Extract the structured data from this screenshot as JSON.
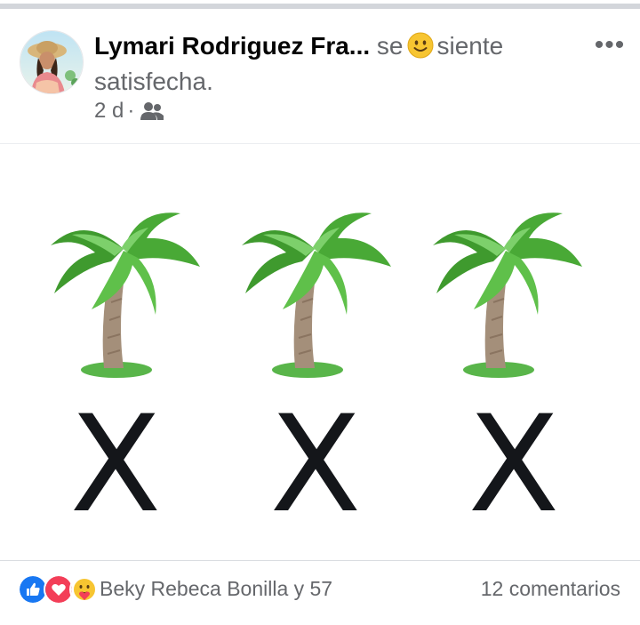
{
  "post": {
    "author": "Lymari Rodriguez Fra...",
    "feeling_prefix": "se",
    "feeling_text": "siente satisfecha.",
    "feeling_emoji": "smile-emoji",
    "time": "2 d",
    "separator": "·",
    "audience_icon": "friends-icon",
    "more_label": "•••"
  },
  "image": {
    "items": [
      {
        "icon": "palm-tree-emoji",
        "mark": "X"
      },
      {
        "icon": "palm-tree-emoji",
        "mark": "X"
      },
      {
        "icon": "palm-tree-emoji",
        "mark": "X"
      }
    ]
  },
  "footer": {
    "reaction_icons": [
      "like-icon",
      "love-icon",
      "care-icon"
    ],
    "reaction_text": "Beky Rebeca Bonilla y 57",
    "comments": "12 comentarios"
  },
  "colors": {
    "like": "#1877f2",
    "love": "#f33e58",
    "text_secondary": "#65676b",
    "text_primary": "#050505"
  }
}
